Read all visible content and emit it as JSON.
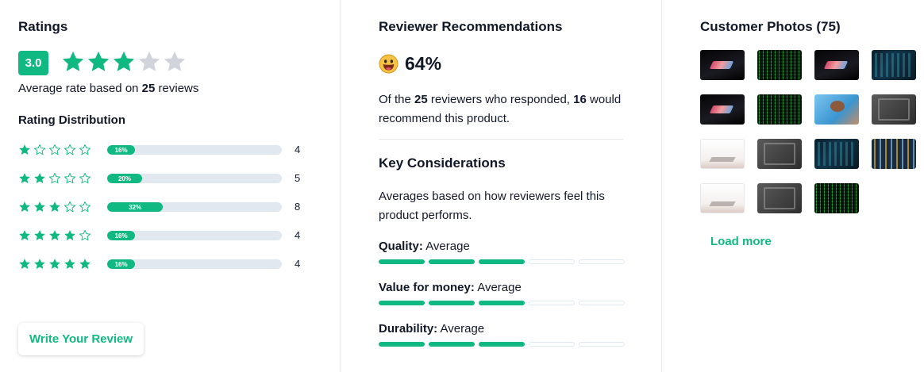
{
  "ratings": {
    "title": "Ratings",
    "score": "3.0",
    "stars_filled": 3,
    "stars_total": 5,
    "avg_prefix": "Average rate based on ",
    "avg_count": "25",
    "avg_suffix": " reviews",
    "distribution_title": "Rating Distribution",
    "distribution": [
      {
        "stars": 1,
        "percent_label": "16%",
        "fraction": 0.16,
        "count": "4"
      },
      {
        "stars": 2,
        "percent_label": "20%",
        "fraction": 0.2,
        "count": "5"
      },
      {
        "stars": 3,
        "percent_label": "32%",
        "fraction": 0.32,
        "count": "8"
      },
      {
        "stars": 4,
        "percent_label": "16%",
        "fraction": 0.16,
        "count": "4"
      },
      {
        "stars": 5,
        "percent_label": "16%",
        "fraction": 0.16,
        "count": "4"
      }
    ],
    "write_review_label": "Write Your Review"
  },
  "recommendations": {
    "title": "Reviewer Recommendations",
    "percent": "64%",
    "text_1": "Of the ",
    "responded_count": "25",
    "text_2": " reviewers who responded, ",
    "recommend_count": "16",
    "text_3": " would recommend this product."
  },
  "considerations": {
    "title": "Key Considerations",
    "intro": "Averages based on how reviewers feel this product performs.",
    "items": [
      {
        "label": "Quality:",
        "value": "Average",
        "level": 3,
        "max": 5
      },
      {
        "label": "Value for money:",
        "value": "Average",
        "level": 3,
        "max": 5
      },
      {
        "label": "Durability:",
        "value": "Average",
        "level": 3,
        "max": 5
      }
    ]
  },
  "photos": {
    "title": "Customer Photos (75)",
    "thumbnails": [
      "laptop",
      "matrix",
      "laptop",
      "code",
      "laptop",
      "matrix",
      "hand",
      "gray",
      "white",
      "gray",
      "code",
      "tech",
      "white",
      "gray",
      "matrix"
    ],
    "load_more_label": "Load more"
  },
  "colors": {
    "accent": "#10b981",
    "empty_star": "#d1d5db",
    "track": "#e2e8f0"
  },
  "icons": {
    "star": "star-icon",
    "emoji": "grinning-face-icon"
  }
}
